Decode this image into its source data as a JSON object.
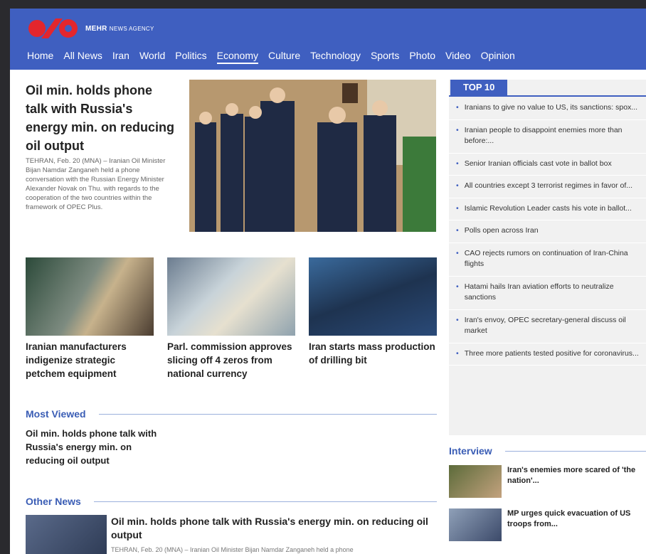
{
  "brand": {
    "name": "MEHR",
    "sub": "NEWS AGENCY"
  },
  "nav": [
    "Home",
    "All News",
    "Iran",
    "World",
    "Politics",
    "Economy",
    "Culture",
    "Technology",
    "Sports",
    "Photo",
    "Video",
    "Opinion"
  ],
  "nav_active": "Economy",
  "lead": {
    "title": "Oil min. holds phone talk with Russia's energy min. on reducing oil output",
    "summary": "TEHRAN, Feb. 20 (MNA) – Iranian Oil Minister Bijan Namdar Zanganeh held a phone conversation with the Russian Energy Minister Alexander Novak on Thu. with regards to the cooperation of the two countries within the framework of OPEC Plus."
  },
  "cards": [
    {
      "title": "Iranian manufacturers indigenize strategic petchem equipment"
    },
    {
      "title": "Parl. commission approves slicing off 4 zeros from national currency"
    },
    {
      "title": "Iran starts mass production of drilling bit"
    }
  ],
  "most_viewed": {
    "heading": "Most Viewed",
    "item": "Oil min. holds phone talk with Russia's energy min. on reducing oil output"
  },
  "other_news": {
    "heading": "Other News",
    "title": "Oil min. holds phone talk with Russia's energy min. on reducing oil output",
    "summary": "TEHRAN, Feb. 20 (MNA) – Iranian Oil Minister Bijan Namdar Zanganeh held a phone"
  },
  "top10": {
    "heading": "TOP 10",
    "items": [
      "Iranians to give no value to US, its sanctions: spox...",
      "Iranian people to disappoint enemies more than before:...",
      "Senior Iranian officials cast vote in ballot box",
      "All countries except 3 terrorist regimes in favor of...",
      "Islamic Revolution Leader casts his vote in ballot...",
      "Polls open across Iran",
      "CAO rejects rumors on continuation of Iran-China flights",
      "Hatami hails Iran aviation efforts to neutralize sanctions",
      "Iran's envoy, OPEC secretary-general discuss oil market",
      "Three more patients tested positive for coronavirus..."
    ]
  },
  "interview": {
    "heading": "Interview",
    "items": [
      "Iran's enemies more scared of 'the nation'...",
      "MP urges quick evacuation of US troops from..."
    ]
  }
}
